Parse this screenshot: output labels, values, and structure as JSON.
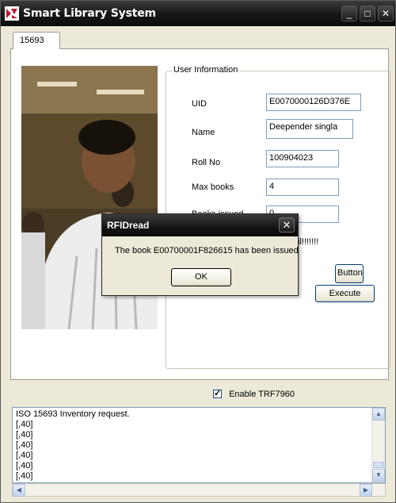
{
  "window": {
    "title": "Smart Library System",
    "controls": [
      "minimize",
      "maximize",
      "close"
    ]
  },
  "tab": {
    "label": "15693"
  },
  "user_info": {
    "title": "User Information",
    "uid_label": "UID",
    "uid_value": "E0070000126D376E",
    "name_label": "Name",
    "name_value": "Deepender singla",
    "roll_label": "Roll No",
    "roll_value": "100904023",
    "max_books_label": "Max books",
    "max_books_value": "4",
    "fifth_label_partial": "Books issued",
    "fifth_value": "0",
    "partial_text": "il!!!!!!!"
  },
  "buttons": {
    "button1": "Button1",
    "execute": "Execute"
  },
  "enable_trf": {
    "label": "Enable TRF7960",
    "checked": true
  },
  "log": {
    "lines": [
      "ISO 15693 Inventory request.",
      "[,40]",
      "[,40]",
      "[,40]",
      "[,40]",
      "[,40]",
      "[,40]"
    ]
  },
  "dialog": {
    "title": "RFIDread",
    "message": "The book E00700001F826615 has been issued",
    "ok_label": "OK"
  }
}
